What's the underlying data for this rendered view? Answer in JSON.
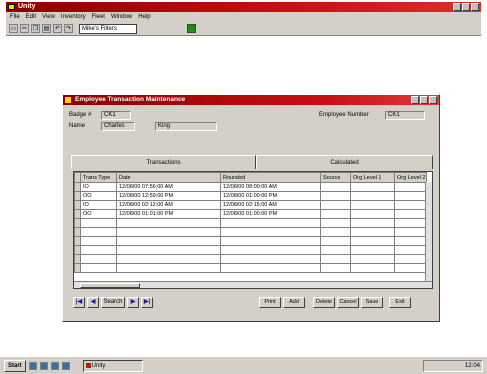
{
  "app": {
    "title": "Unity"
  },
  "menu": [
    "File",
    "Edit",
    "View",
    "Inventory",
    "Fleet",
    "Window",
    "Help"
  ],
  "toolbar": {
    "combo_value": "Mike's Filters"
  },
  "dialog": {
    "title": "Employee Transaction Maintenance",
    "badge_label": "Badge #",
    "badge_value": "CK1",
    "name_label": "Name",
    "first_name": "Charles",
    "last_name": "King",
    "empnum_label": "Employee Number",
    "empnum_value": "CK1",
    "tabs": [
      "Transactions",
      "Calculated"
    ],
    "columns": [
      "Trans Type",
      "Date",
      "Rounded",
      "Source",
      "Org Level 1",
      "Org Level 2"
    ],
    "rows": [
      [
        "IO",
        "12/08/00 07:56:00 AM",
        "12/08/00 08:00:00 AM",
        "",
        "",
        ""
      ],
      [
        "OO",
        "12/08/00 12:59:00 PM",
        "12/08/00 01:00:00 PM",
        "",
        "",
        ""
      ],
      [
        "IO",
        "12/08/00 02:12:00 AM",
        "12/08/00 02:15:00 AM",
        "",
        "",
        ""
      ],
      [
        "OO",
        "12/08/00 01:01:00 PM",
        "12/08/00 01:00:00 PM",
        "",
        "",
        ""
      ]
    ],
    "nav": {
      "first": "|◀",
      "prev": "◀",
      "search": "Search",
      "next": "▶",
      "last": "▶|"
    },
    "actions": [
      "Print",
      "Add",
      "Delete",
      "Cancel",
      "Save",
      "Exit"
    ]
  },
  "taskbar": {
    "start": "Start",
    "task": "Unity",
    "clock": "12:04"
  },
  "colors": {
    "title_red": "#c81010",
    "chrome": "#d4d0c8"
  }
}
